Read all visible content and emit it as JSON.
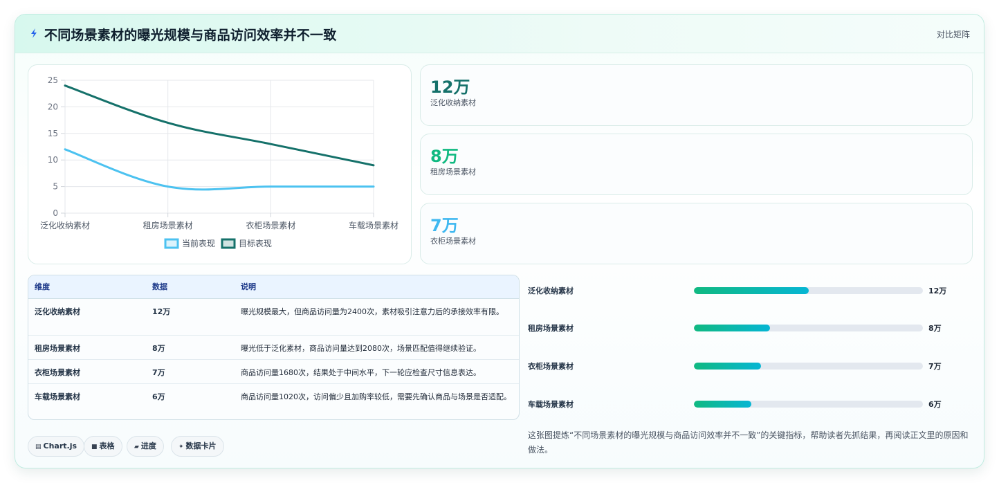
{
  "header": {
    "title": "不同场景素材的曝光规模与商品访问效率并不一致",
    "tag": "对比矩阵"
  },
  "chart_data": {
    "type": "line",
    "categories": [
      "泛化收纳素材",
      "租房场景素材",
      "衣柜场景素材",
      "车载场景素材"
    ],
    "ylim": [
      0,
      25
    ],
    "yticks": [
      0,
      5,
      10,
      15,
      20,
      25
    ],
    "grid": true,
    "legend_position": "bottom",
    "series": [
      {
        "name": "当前表现",
        "values": [
          12,
          5,
          5,
          5
        ],
        "color": "#4cc2f0"
      },
      {
        "name": "目标表现",
        "values": [
          24,
          17,
          13,
          9
        ],
        "color": "#15716a"
      }
    ]
  },
  "kpis": [
    {
      "value": "12万",
      "label": "泛化收纳素材",
      "color": "#15716a"
    },
    {
      "value": "8万",
      "label": "租房场景素材",
      "color": "#10b981"
    },
    {
      "value": "7万",
      "label": "衣柜场景素材",
      "color": "#3fb8f0"
    }
  ],
  "table": {
    "headers": [
      "维度",
      "数据",
      "说明"
    ],
    "rows": [
      [
        "泛化收纳素材",
        "12万",
        "曝光规模最大，但商品访问量为2400次，素材吸引注意力后的承接效率有限。"
      ],
      [
        "租房场景素材",
        "8万",
        "曝光低于泛化素材，商品访问量达到2080次，场景匹配值得继续验证。"
      ],
      [
        "衣柜场景素材",
        "7万",
        "商品访问量1680次，结果处于中间水平，下一轮应检查尺寸信息表达。"
      ],
      [
        "车载场景素材",
        "6万",
        "商品访问量1020次，访问偏少且加购率较低，需要先确认商品与场景是否适配。"
      ]
    ]
  },
  "bars": [
    {
      "label": "泛化收纳素材",
      "value_text": "12万",
      "fraction": 0.5
    },
    {
      "label": "租房场景素材",
      "value_text": "8万",
      "fraction": 0.333
    },
    {
      "label": "衣柜场景素材",
      "value_text": "7万",
      "fraction": 0.292
    },
    {
      "label": "车载场景素材",
      "value_text": "6万",
      "fraction": 0.25
    }
  ],
  "chips": [
    {
      "icon": "chart-icon",
      "label": "Chart.js"
    },
    {
      "icon": "table-icon",
      "label": "表格"
    },
    {
      "icon": "progress-icon",
      "label": "进度"
    },
    {
      "icon": "sparkle-icon",
      "label": "数据卡片"
    }
  ],
  "note": "这张图提炼“不同场景素材的曝光规模与商品访问效率并不一致”的关键指标，帮助读者先抓结果，再阅读正文里的原因和做法。"
}
